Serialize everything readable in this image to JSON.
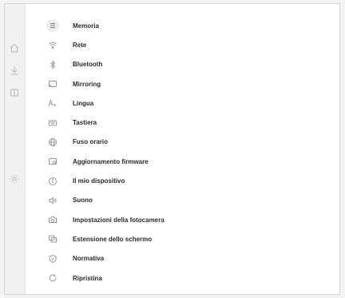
{
  "rail": {
    "icons": [
      "home-icon",
      "download-icon",
      "library-icon",
      "settings-gear-icon"
    ]
  },
  "settings": {
    "items": [
      {
        "label": "Memoria",
        "icon": "storage-icon",
        "active": true
      },
      {
        "label": "Rete",
        "icon": "wifi-icon"
      },
      {
        "label": "Bluetooth",
        "icon": "bluetooth-icon"
      },
      {
        "label": "Mirroring",
        "icon": "mirroring-icon"
      },
      {
        "label": "Lingua",
        "icon": "language-icon"
      },
      {
        "label": "Tastiera",
        "icon": "keyboard-icon"
      },
      {
        "label": "Fuso orario",
        "icon": "globe-icon"
      },
      {
        "label": "Aggiornamento firmware",
        "icon": "firmware-update-icon"
      },
      {
        "label": "Il mio dispositivo",
        "icon": "info-icon"
      },
      {
        "label": "Suono",
        "icon": "speaker-icon"
      },
      {
        "label": "Impostazioni della fotocamera",
        "icon": "camera-icon"
      },
      {
        "label": "Estensione dello schermo",
        "icon": "screen-extension-icon"
      },
      {
        "label": "Normativa",
        "icon": "regulatory-icon"
      },
      {
        "label": "Ripristina",
        "icon": "reset-icon"
      }
    ]
  }
}
